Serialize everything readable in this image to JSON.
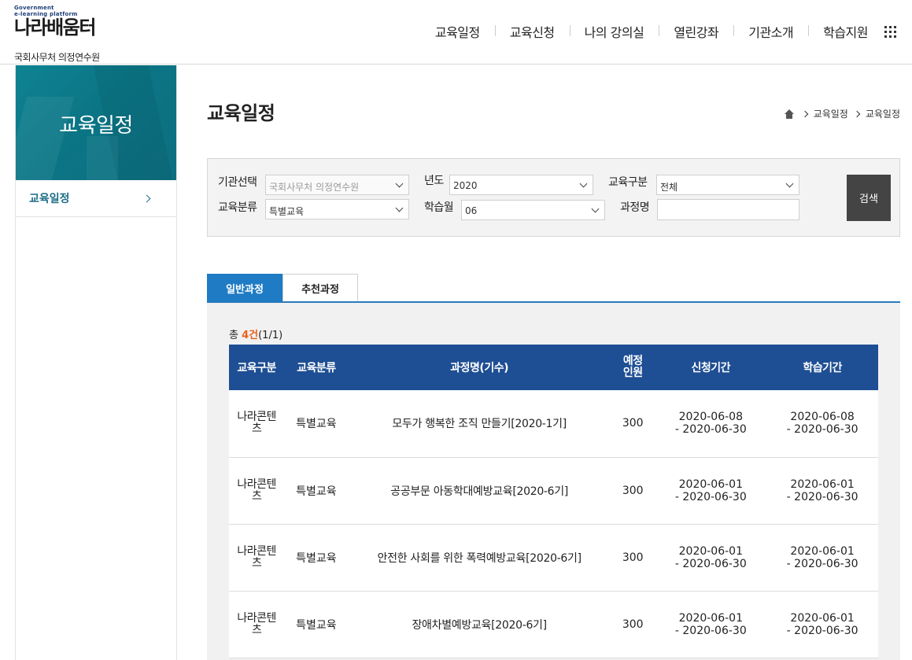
{
  "header": {
    "logo_sub": "Government\ne-learning platform",
    "logo_main": "나라배움터",
    "org_name": "국회사무처 의정연수원",
    "nav": [
      "교육일정",
      "교육신청",
      "나의 강의실",
      "열린강좌",
      "기관소개",
      "학습지원"
    ]
  },
  "sidebar": {
    "hero_title": "교육일정",
    "menu_item": "교육일정"
  },
  "page": {
    "title": "교육일정",
    "breadcrumb": [
      "교육일정",
      "교육일정"
    ]
  },
  "search": {
    "agency_label": "기관선택",
    "agency_value": "국회사무처 의정연수원",
    "year_label": "년도",
    "year_value": "2020",
    "edu_type_label": "교육구분",
    "edu_type_value": "전체",
    "category_label": "교육분류",
    "category_value": "특별교육",
    "month_label": "학습월",
    "month_value": "06",
    "course_label": "과정명",
    "course_value": "",
    "search_button": "검색"
  },
  "tabs": [
    "일반과정",
    "추천과정"
  ],
  "result": {
    "count_prefix": "총 ",
    "count_num": "4건",
    "count_suffix": "(1/1)",
    "columns": [
      "교육구분",
      "교육분류",
      "과정명(기수)",
      "예정\n인원",
      "신청기간",
      "학습기간"
    ],
    "rows": [
      {
        "type": "나라콘텐\n츠",
        "category": "특별교육",
        "course": "모두가 행복한 조직 만들기[2020-1기]",
        "seats": "300",
        "apply": "2020-06-08\n- 2020-06-30",
        "study": "2020-06-08\n- 2020-06-30"
      },
      {
        "type": "나라콘텐\n츠",
        "category": "특별교육",
        "course": "공공부문 아동학대예방교육[2020-6기]",
        "seats": "300",
        "apply": "2020-06-01\n- 2020-06-30",
        "study": "2020-06-01\n- 2020-06-30"
      },
      {
        "type": "나라콘텐\n츠",
        "category": "특별교육",
        "course": "안전한 사회를 위한 폭력예방교육[2020-6기]",
        "seats": "300",
        "apply": "2020-06-01\n- 2020-06-30",
        "study": "2020-06-01\n- 2020-06-30"
      },
      {
        "type": "나라콘텐\n츠",
        "category": "특별교육",
        "course": "장애차별예방교육[2020-6기]",
        "seats": "300",
        "apply": "2020-06-01\n- 2020-06-30",
        "study": "2020-06-01\n- 2020-06-30"
      }
    ]
  },
  "colors": {
    "sidebar_teal": "#0b7585",
    "table_header": "#1e4e93",
    "tab_active": "#1f7cc4",
    "count_accent": "#e8631a",
    "search_button": "#444444"
  }
}
